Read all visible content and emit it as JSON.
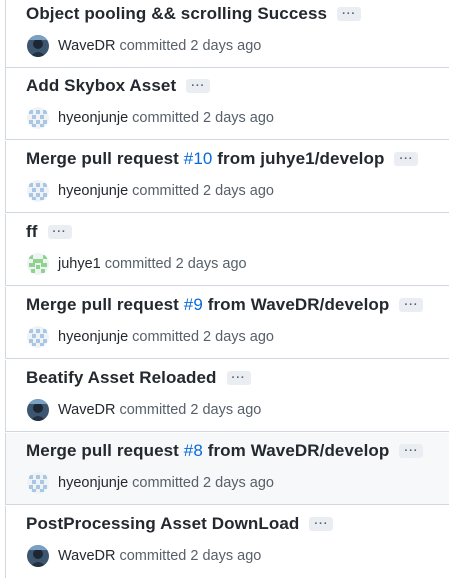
{
  "commits": [
    {
      "title_text": "Object pooling && scrolling Success",
      "pr_number": "",
      "title_suffix": "",
      "author": "WaveDR",
      "avatar": "wavedr-avatar",
      "action": "committed",
      "time": "2 days ago"
    },
    {
      "title_text": "Add Skybox Asset",
      "pr_number": "",
      "title_suffix": "",
      "author": "hyeonjunje",
      "avatar": "identicon-blue",
      "action": "committed",
      "time": "2 days ago"
    },
    {
      "title_text": "Merge pull request ",
      "pr_number": "#10",
      "title_suffix": " from juhye1/develop",
      "author": "hyeonjunje",
      "avatar": "identicon-blue",
      "action": "committed",
      "time": "2 days ago"
    },
    {
      "title_text": "ff",
      "pr_number": "",
      "title_suffix": "",
      "author": "juhye1",
      "avatar": "identicon-green",
      "action": "committed",
      "time": "2 days ago"
    },
    {
      "title_text": "Merge pull request ",
      "pr_number": "#9",
      "title_suffix": " from WaveDR/develop",
      "author": "hyeonjunje",
      "avatar": "identicon-blue",
      "action": "committed",
      "time": "2 days ago"
    },
    {
      "title_text": "Beatify Asset Reloaded",
      "pr_number": "",
      "title_suffix": "",
      "author": "WaveDR",
      "avatar": "wavedr-avatar",
      "action": "committed",
      "time": "2 days ago"
    },
    {
      "title_text": "Merge pull request ",
      "pr_number": "#8",
      "title_suffix": " from WaveDR/develop",
      "author": "hyeonjunje",
      "avatar": "identicon-blue",
      "action": "committed",
      "time": "2 days ago"
    },
    {
      "title_text": "PostProcessing Asset DownLoad",
      "pr_number": "",
      "title_suffix": "",
      "author": "WaveDR",
      "avatar": "wavedr-avatar",
      "action": "committed",
      "time": "2 days ago"
    }
  ],
  "ellipsis_label": "···",
  "colors": {
    "link": "#0969da",
    "muted": "#57606a",
    "text": "#24292f",
    "border": "#d0d7de",
    "hover_bg": "#f6f8fa",
    "identicon_blue": "#a9c6e4",
    "identicon_green": "#8fd48b"
  }
}
